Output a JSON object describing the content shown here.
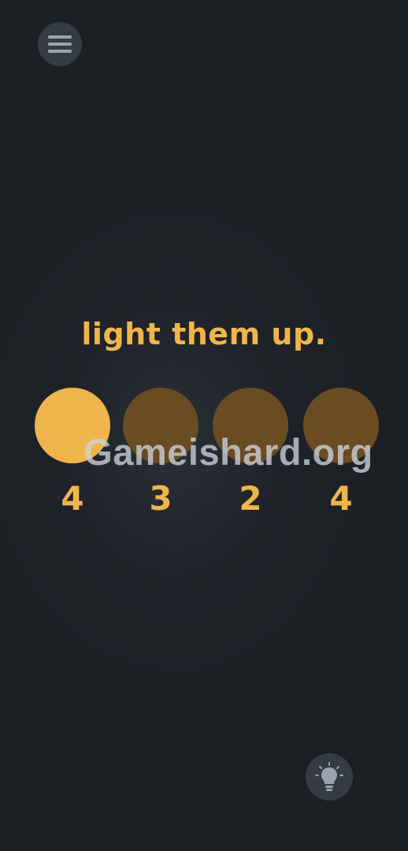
{
  "colors": {
    "light_on": "#f0b54a",
    "light_off": "#6a4b22",
    "text": "#f0b54a",
    "button_bg": "#353b45",
    "icon": "#9aa3ad"
  },
  "menu": {
    "icon": "hamburger-menu-icon"
  },
  "title": "light them up.",
  "lights": [
    {
      "lit": true,
      "count": "4"
    },
    {
      "lit": false,
      "count": "3"
    },
    {
      "lit": false,
      "count": "2"
    },
    {
      "lit": false,
      "count": "4"
    }
  ],
  "watermark": "Gameishard.org",
  "hint": {
    "icon": "lightbulb-icon"
  }
}
